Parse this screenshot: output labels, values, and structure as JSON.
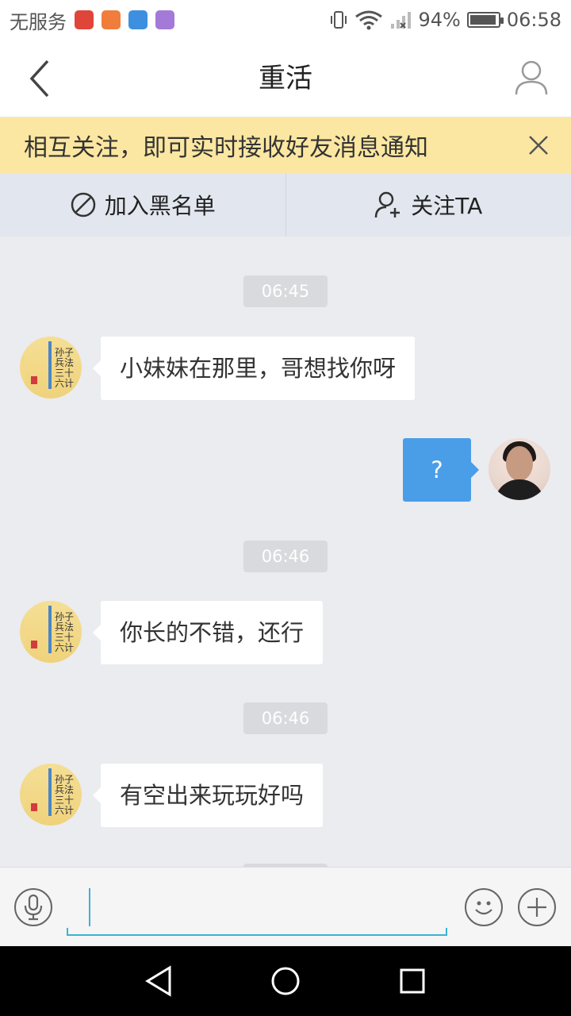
{
  "status_bar": {
    "carrier": "无服务",
    "battery": "94%",
    "battery_level": 0.94,
    "time": "06:58",
    "app_icons": [
      "toutiao-icon",
      "app-icon",
      "shield-app-icon",
      "gallery-app-icon"
    ],
    "colors": {
      "toutiao": "#e0453a",
      "app": "#f07d3c",
      "shield": "#3d8fe0",
      "gallery": "#a47ad8"
    }
  },
  "header": {
    "title": "重活",
    "back_icon": "chevron-left-icon",
    "profile_icon": "user-icon"
  },
  "notice": {
    "text": "相互关注，即可实时接收好友消息通知",
    "close_icon": "close-icon"
  },
  "actions": {
    "blacklist_label": "加入黑名单",
    "follow_label": "关注TA"
  },
  "chat": {
    "messages": [
      {
        "kind": "time",
        "text": "06:45"
      },
      {
        "kind": "incoming",
        "text": "小妹妹在那里，哥想找你呀"
      },
      {
        "kind": "outgoing",
        "text": "?"
      },
      {
        "kind": "time",
        "text": "06:46"
      },
      {
        "kind": "incoming",
        "text": "你长的不错，还行"
      },
      {
        "kind": "time",
        "text": "06:46"
      },
      {
        "kind": "incoming",
        "text": "有空出来玩玩好吗"
      }
    ],
    "book_avatar_text": "孙子兵法三十六计"
  },
  "input_bar": {
    "value": "",
    "voice_icon": "microphone-icon",
    "emoji_icon": "smiley-icon",
    "more_icon": "plus-icon"
  },
  "navbar": {
    "back_icon": "nav-back-icon",
    "home_icon": "nav-home-icon",
    "recents_icon": "nav-recents-icon"
  },
  "colors": {
    "accent": "#4a9ee8",
    "notice_bg": "#fbe7a1",
    "chat_bg": "#ebecf0",
    "input_accent": "#3ab4d4"
  }
}
